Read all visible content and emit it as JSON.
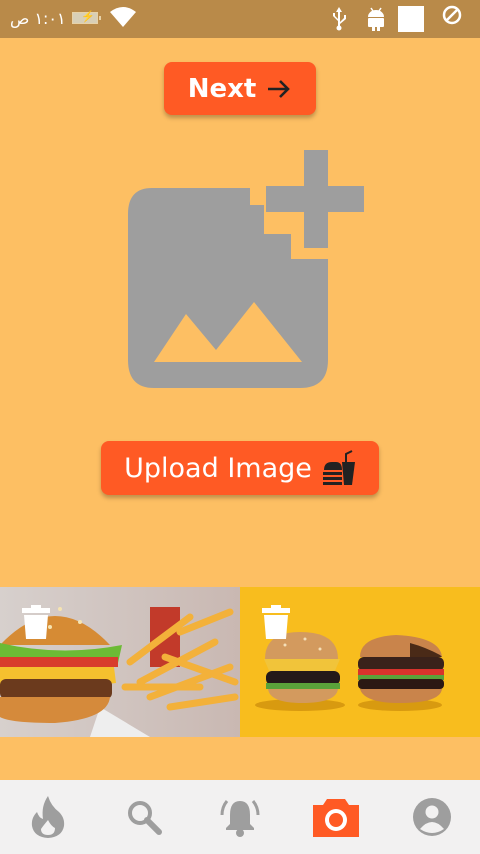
{
  "status_bar": {
    "time": "١:٠١ ص",
    "icons": [
      "battery-charging-icon",
      "wifi-icon",
      "usb-icon",
      "android-icon",
      "notification-square-icon",
      "do-not-disturb-icon"
    ]
  },
  "actions": {
    "next_label": "Next",
    "upload_label": "Upload Image"
  },
  "placeholder": {
    "icon": "add-photo-icon"
  },
  "gallery": {
    "photos": [
      {
        "subject": "burger-with-fries-photo",
        "delete_icon": "trash-icon"
      },
      {
        "subject": "two-burgers-yellow-background-photo",
        "delete_icon": "trash-icon"
      }
    ]
  },
  "bottom_nav": {
    "items": [
      "flame-icon",
      "search-icon",
      "bell-icon",
      "camera-icon",
      "account-icon"
    ],
    "active_index": 3
  },
  "colors": {
    "background": "#FDBF63",
    "status_bar": "#B98A49",
    "accent": "#FF5A24",
    "icon_gray": "#9E9E9E",
    "nav_background": "#F2F1F1"
  }
}
